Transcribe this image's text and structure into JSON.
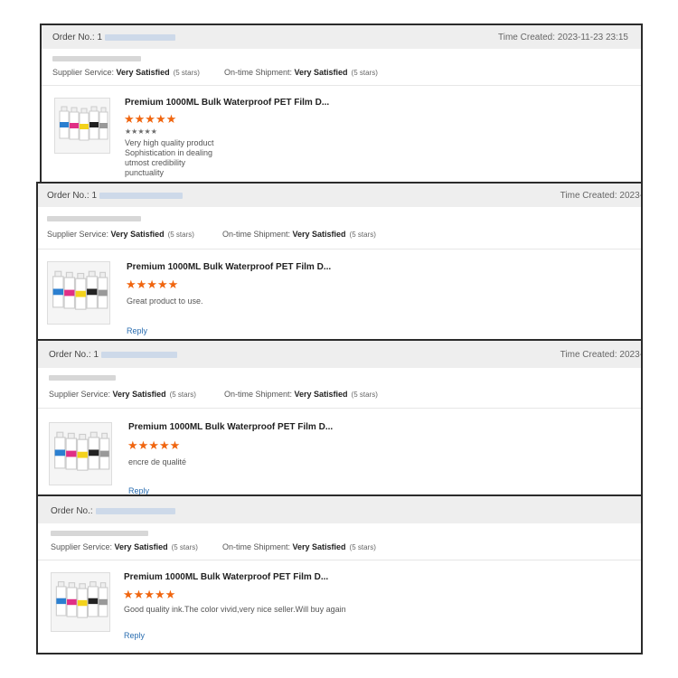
{
  "reviews": [
    {
      "order_label": "Order No.: 1",
      "time_created": "Time Created: 2023-11-23 23:15",
      "supplier_label": "Supplier Service: ",
      "supplier_value": "Very Satisfied",
      "supplier_stars": "(5 stars)",
      "shipment_label": "On-time Shipment: ",
      "shipment_value": "Very Satisfied",
      "shipment_stars": "(5 stars)",
      "product_title": "Premium 1000ML Bulk Waterproof PET Film D...",
      "rating_stars": "★★★★★",
      "sub_stars": "★★★★★",
      "comment_lines": [
        "Very high quality product",
        "Sophistication in dealing",
        "utmost credibility",
        "punctuality"
      ],
      "reply_label": ""
    },
    {
      "order_label": "Order No.: 1",
      "time_created": "Time Created: 2023-",
      "supplier_label": "Supplier Service: ",
      "supplier_value": "Very Satisfied",
      "supplier_stars": "(5 stars)",
      "shipment_label": "On-time Shipment: ",
      "shipment_value": "Very Satisfied",
      "shipment_stars": "(5 stars)",
      "product_title": "Premium 1000ML Bulk Waterproof PET Film D...",
      "rating_stars": "★★★★★",
      "comment_lines": [
        "Great product to use."
      ],
      "reply_label": "Reply"
    },
    {
      "order_label": "Order No.: 1",
      "time_created": "Time Created: 2023-",
      "supplier_label": "Supplier Service: ",
      "supplier_value": "Very Satisfied",
      "supplier_stars": "(5 stars)",
      "shipment_label": "On-time Shipment: ",
      "shipment_value": "Very Satisfied",
      "shipment_stars": "(5 stars)",
      "product_title": "Premium 1000ML Bulk Waterproof PET Film D...",
      "rating_stars": "★★★★★",
      "comment_lines": [
        "encre de qualité"
      ],
      "reply_label": "Reply"
    },
    {
      "order_label": "Order No.:",
      "time_created": "",
      "supplier_label": "Supplier Service: ",
      "supplier_value": "Very Satisfied",
      "supplier_stars": "(5 stars)",
      "shipment_label": "On-time Shipment: ",
      "shipment_value": "Very Satisfied",
      "shipment_stars": "(5 stars)",
      "product_title": "Premium 1000ML Bulk Waterproof PET Film D...",
      "rating_stars": "★★★★★",
      "comment_lines": [
        "Good quality ink.The color vivid,very nice seller.Will buy again"
      ],
      "reply_label": "Reply"
    }
  ],
  "colors": {
    "star": "#f0650f",
    "link": "#2a6db0",
    "header_bg": "#eeeeee",
    "border": "#2b2b2b"
  },
  "icons": {
    "product_image": "ink-bottles-image"
  }
}
